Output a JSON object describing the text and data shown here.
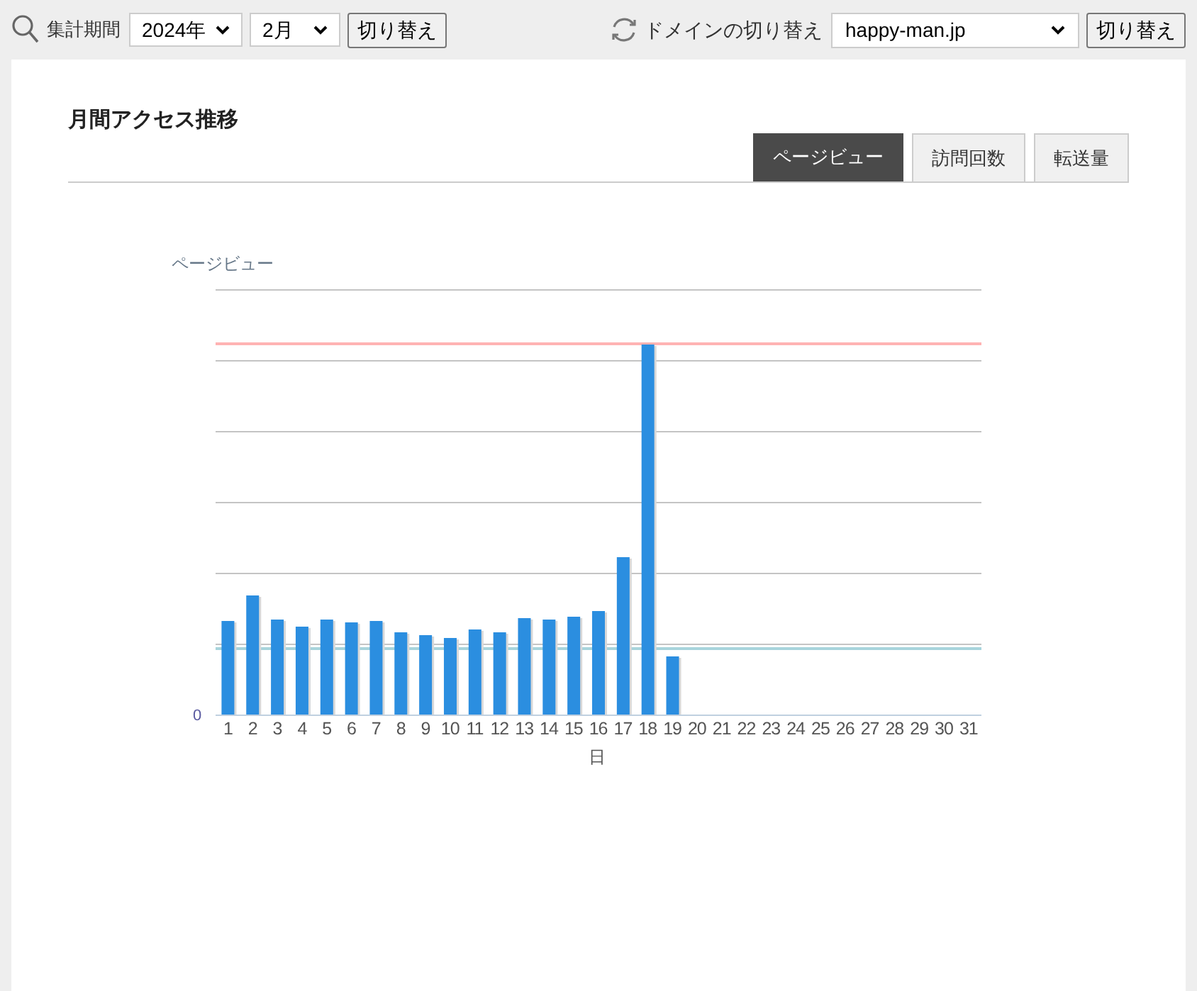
{
  "filter_bar": {
    "period_label": "集計期間",
    "year": "2024年",
    "month": "2月",
    "period_button": "切り替え",
    "domain_label": "ドメインの切り替え",
    "domain": "happy-man.jp",
    "domain_button": "切り替え"
  },
  "panel": {
    "title": "月間アクセス推移",
    "tabs": [
      {
        "label": "ページビュー",
        "selected": true
      },
      {
        "label": "訪問回数",
        "selected": false
      },
      {
        "label": "転送量",
        "selected": false
      }
    ]
  },
  "chart": {
    "y_title": "ページビュー",
    "y_zero": "0",
    "x_title": "日",
    "x_labels": [
      "1",
      "2",
      "3",
      "4",
      "5",
      "6",
      "7",
      "8",
      "9",
      "10",
      "11",
      "12",
      "13",
      "14",
      "15",
      "16",
      "17",
      "18",
      "19",
      "20",
      "21",
      "22",
      "23",
      "24",
      "25",
      "26",
      "27",
      "28",
      "29",
      "30",
      "31"
    ]
  }
}
